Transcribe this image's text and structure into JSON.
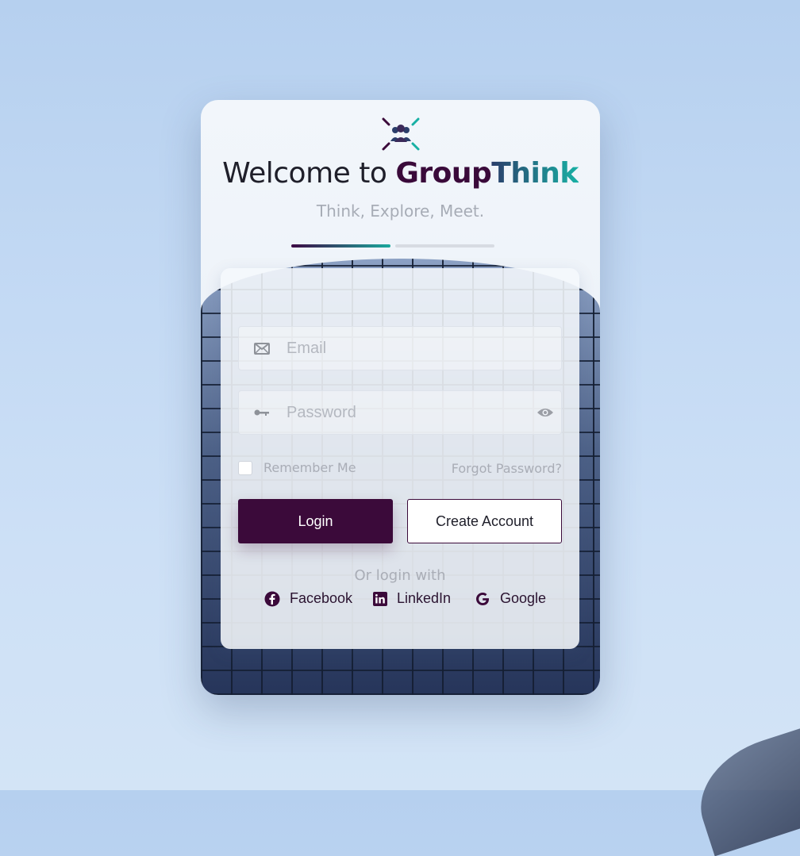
{
  "brand": {
    "welcome": "Welcome to",
    "name_part1": "Group",
    "name_part2": "Think",
    "tagline": "Think, Explore, Meet."
  },
  "form": {
    "email_placeholder": "Email",
    "password_placeholder": "Password",
    "remember_label": "Remember Me",
    "forgot_label": "Forgot Password?",
    "login_label": "Login",
    "create_label": "Create Account"
  },
  "social": {
    "heading": "Or login with",
    "providers": [
      {
        "label": "Facebook",
        "icon": "facebook-icon"
      },
      {
        "label": "LinkedIn",
        "icon": "linkedin-icon"
      },
      {
        "label": "Google",
        "icon": "google-icon"
      }
    ]
  },
  "colors": {
    "primary": "#3b0a3a",
    "accent": "#18b0a4"
  }
}
